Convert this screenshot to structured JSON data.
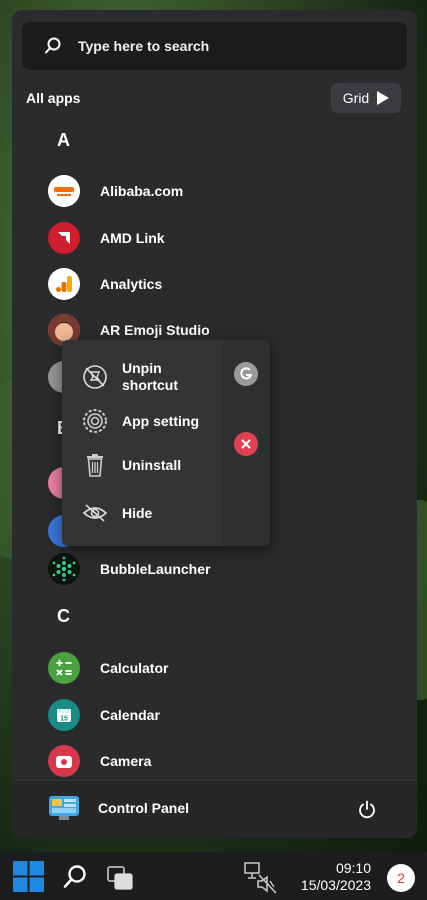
{
  "search": {
    "placeholder": "Type here to search"
  },
  "header": {
    "all_apps": "All apps",
    "grid_label": "Grid"
  },
  "sections": [
    {
      "letter": "A",
      "apps": [
        "Alibaba.com",
        "AMD Link",
        "Analytics",
        "AR Emoji Studio"
      ]
    },
    {
      "letter": "B",
      "apps": [
        "BubbleLauncher"
      ]
    },
    {
      "letter": "C",
      "apps": [
        "Calculator",
        "Calendar",
        "Camera"
      ]
    }
  ],
  "context_menu": {
    "items": [
      "Unpin\nshortcut",
      "App setting",
      "Uninstall",
      "Hide"
    ]
  },
  "bottom": {
    "control_panel": "Control Panel"
  },
  "taskbar": {
    "time": "09:10",
    "date": "15/03/2023",
    "notifications": "2"
  },
  "colors": {
    "accent": "#1e88e5",
    "close_red": "#e0434f"
  }
}
